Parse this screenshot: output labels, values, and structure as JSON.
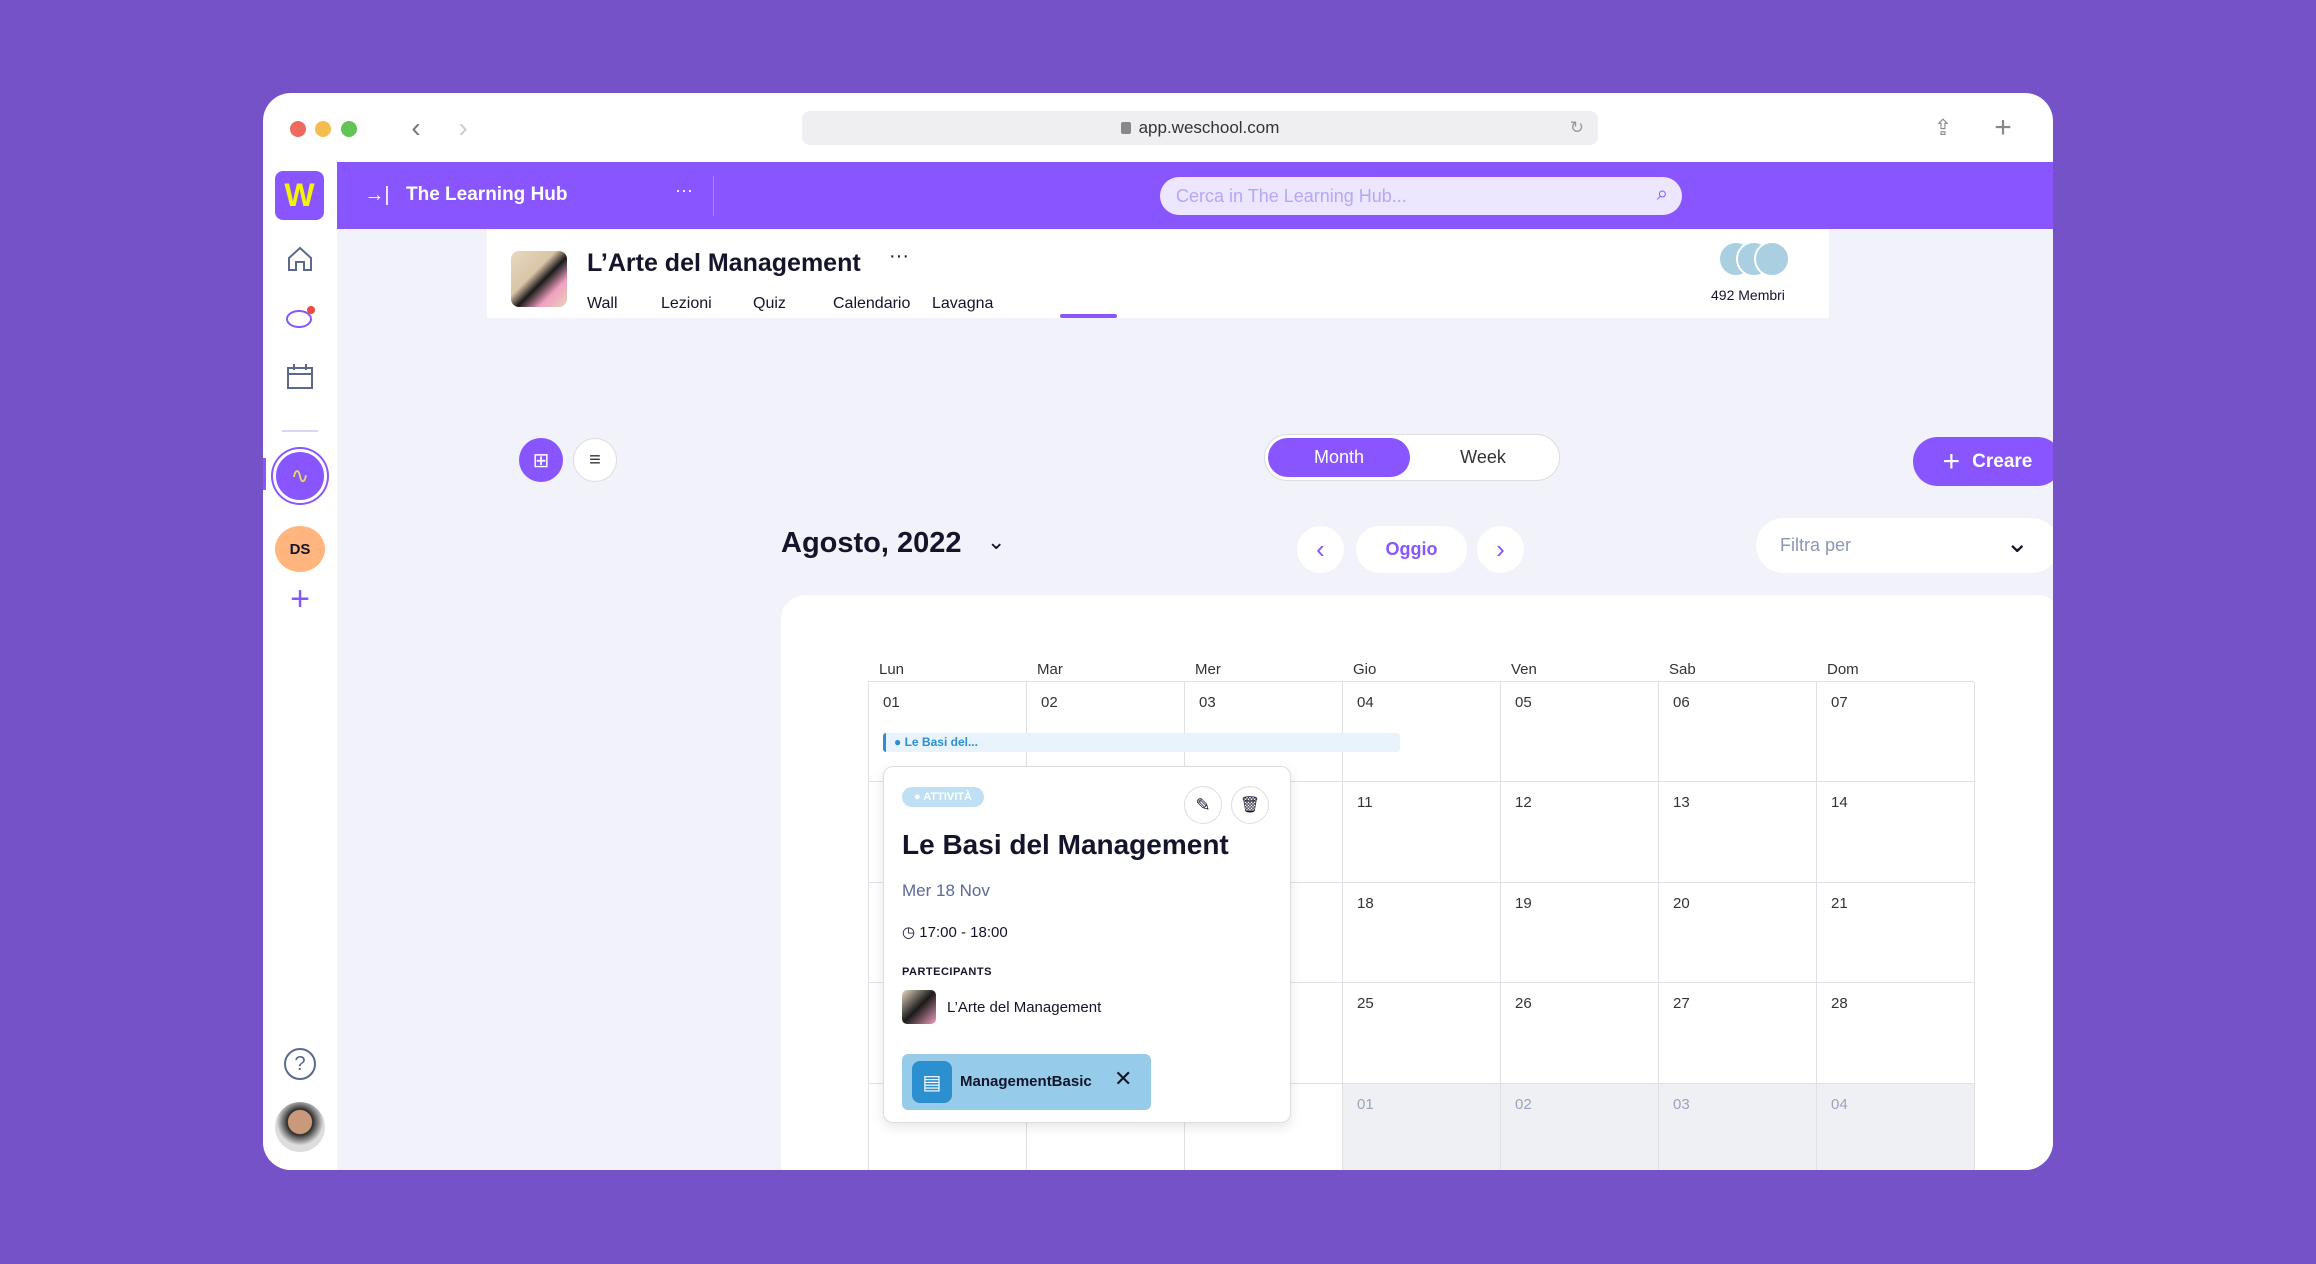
{
  "browser": {
    "url": "app.weschool.com"
  },
  "topbar": {
    "logo": "W",
    "space_title": "The Learning Hub",
    "more": "···",
    "search_placeholder": "Cerca in The Learning Hub..."
  },
  "sidebar": {
    "group_initials": "DS"
  },
  "course": {
    "title": "L’Arte del Management",
    "more": "···",
    "tabs": [
      "Wall",
      "Lezioni",
      "Quiz",
      "Calendario",
      "Lavagna"
    ],
    "members": "492 Membri"
  },
  "toolbar": {
    "view_options": [
      "Month",
      "Week"
    ],
    "selected_view": "Month",
    "create_label": "Creare"
  },
  "calendar": {
    "month_label": "Agosto, 2022",
    "today_label": "Oggio",
    "filter_placeholder": "Filtra per",
    "weekdays": [
      "Lun",
      "Mar",
      "Mer",
      "Gio",
      "Ven",
      "Sab",
      "Dom"
    ],
    "weeks": [
      [
        {
          "day": "01"
        },
        {
          "day": "02"
        },
        {
          "day": "03"
        },
        {
          "day": "04"
        },
        {
          "day": "05"
        },
        {
          "day": "06"
        },
        {
          "day": "07"
        }
      ],
      [
        {
          "day": ""
        },
        {
          "day": ""
        },
        {
          "day": ""
        },
        {
          "day": "11"
        },
        {
          "day": "12"
        },
        {
          "day": "13"
        },
        {
          "day": "14"
        }
      ],
      [
        {
          "day": ""
        },
        {
          "day": ""
        },
        {
          "day": ""
        },
        {
          "day": "18"
        },
        {
          "day": "19"
        },
        {
          "day": "20"
        },
        {
          "day": "21"
        }
      ],
      [
        {
          "day": ""
        },
        {
          "day": ""
        },
        {
          "day": ""
        },
        {
          "day": "25"
        },
        {
          "day": "26"
        },
        {
          "day": "27"
        },
        {
          "day": "28"
        }
      ],
      [
        {
          "day": ""
        },
        {
          "day": ""
        },
        {
          "day": ""
        },
        {
          "day": "01",
          "muted": true
        },
        {
          "day": "02",
          "muted": true
        },
        {
          "day": "03",
          "muted": true
        },
        {
          "day": "04",
          "muted": true
        }
      ]
    ],
    "event_bar": "Le Basi del..."
  },
  "popup": {
    "badge": "ATTIVITÀ",
    "title": "Le Basi del Management",
    "date": "Mer 18 Nov",
    "time": "17:00 - 18:00",
    "participants_label": "PARTECIPANTS",
    "participant": "L’Arte del Management",
    "resource": "ManagementBasic"
  },
  "colors": {
    "brand": "#8855FF",
    "background": "#7652C9",
    "event": "#2B8FD0"
  }
}
